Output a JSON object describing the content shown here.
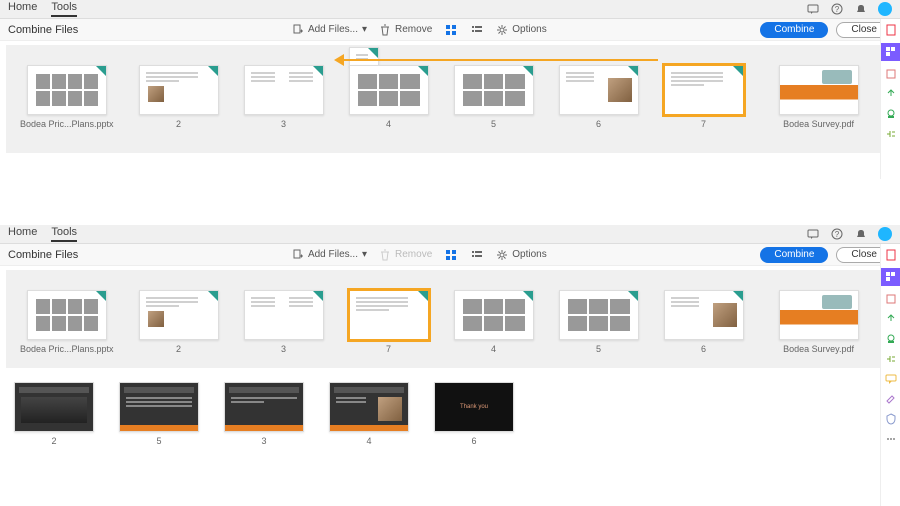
{
  "top": {
    "tabs": [
      "Home",
      "Tools"
    ],
    "active_tab": "Tools"
  },
  "subbar": {
    "title": "Combine Files",
    "add_files": "Add Files...",
    "remove": "Remove",
    "options": "Options",
    "combine": "Combine",
    "close": "Close"
  },
  "panel1": {
    "thumbs": [
      {
        "label": "Bodea Pric...Plans.pptx",
        "kind": "grid"
      },
      {
        "label": "2",
        "kind": "text-photo"
      },
      {
        "label": "3",
        "kind": "two-col"
      },
      {
        "label": "4",
        "kind": "tables",
        "has_mini": true
      },
      {
        "label": "5",
        "kind": "tables"
      },
      {
        "label": "6",
        "kind": "photo-right"
      },
      {
        "label": "7",
        "kind": "text-lines",
        "highlight": true
      },
      {
        "label": "Bodea Survey.pdf",
        "kind": "car"
      }
    ]
  },
  "panel2": {
    "thumbs_row1": [
      {
        "label": "Bodea Pric...Plans.pptx",
        "kind": "grid"
      },
      {
        "label": "2",
        "kind": "text-photo"
      },
      {
        "label": "3",
        "kind": "two-col"
      },
      {
        "label": "7",
        "kind": "text-lines",
        "highlight": true
      },
      {
        "label": "4",
        "kind": "tables"
      },
      {
        "label": "5",
        "kind": "tables"
      },
      {
        "label": "6",
        "kind": "photo-right"
      },
      {
        "label": "Bodea Survey.pdf",
        "kind": "car"
      }
    ],
    "thumbs_row2": [
      {
        "label": "2",
        "kind": "dark"
      },
      {
        "label": "5",
        "kind": "dark-text"
      },
      {
        "label": "3",
        "kind": "dark"
      },
      {
        "label": "4",
        "kind": "dark-photo"
      },
      {
        "label": "6",
        "kind": "dark-blank"
      }
    ]
  },
  "rail_icons": [
    "pdf",
    "combine",
    "crop",
    "export",
    "stamp",
    "organize",
    "comment",
    "fill",
    "redact",
    "protect",
    "more"
  ]
}
